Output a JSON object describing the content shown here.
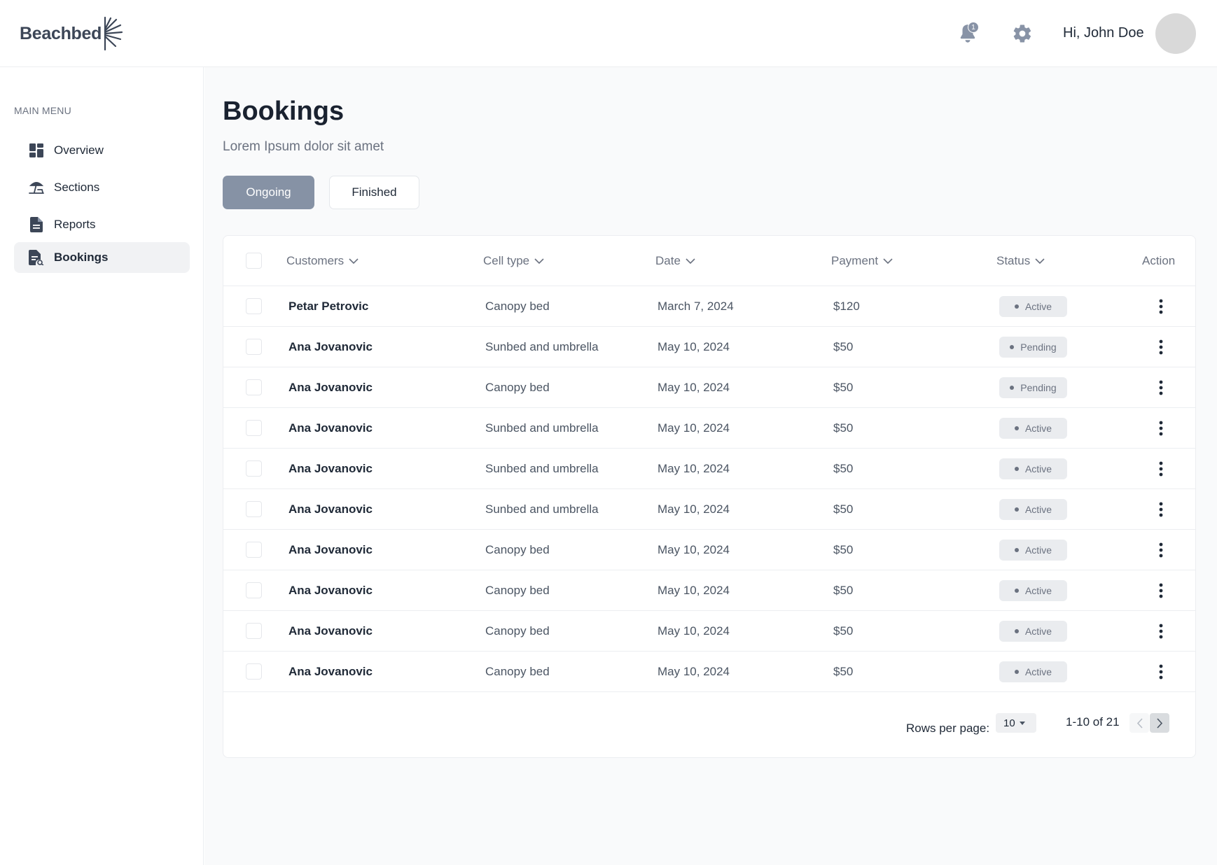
{
  "app": {
    "brand": "Beachbed"
  },
  "header": {
    "notification_count": "1",
    "greeting": "Hi, John Doe"
  },
  "sidebar": {
    "heading": "MAIN MENU",
    "items": [
      {
        "label": "Overview",
        "icon": "dashboard-icon"
      },
      {
        "label": "Sections",
        "icon": "beach-umbrella-icon"
      },
      {
        "label": "Reports",
        "icon": "document-icon"
      },
      {
        "label": "Bookings",
        "icon": "bookings-icon",
        "active": true
      }
    ]
  },
  "page": {
    "title": "Bookings",
    "subtitle": "Lorem Ipsum dolor sit amet",
    "tabs": [
      {
        "label": "Ongoing",
        "active": true
      },
      {
        "label": "Finished",
        "active": false
      }
    ]
  },
  "table": {
    "columns": {
      "customers": "Customers",
      "cell_type": "Cell type",
      "date": "Date",
      "payment": "Payment",
      "status": "Status",
      "action": "Action"
    },
    "rows": [
      {
        "customer": "Petar Petrovic",
        "cell_type": "Canopy bed",
        "date": "March 7, 2024",
        "payment": "$120",
        "status": "Active"
      },
      {
        "customer": "Ana Jovanovic",
        "cell_type": "Sunbed and umbrella",
        "date": "May 10, 2024",
        "payment": "$50",
        "status": "Pending"
      },
      {
        "customer": "Ana Jovanovic",
        "cell_type": "Canopy bed",
        "date": "May 10, 2024",
        "payment": "$50",
        "status": "Pending"
      },
      {
        "customer": "Ana Jovanovic",
        "cell_type": "Sunbed and umbrella",
        "date": "May 10, 2024",
        "payment": "$50",
        "status": "Active"
      },
      {
        "customer": "Ana Jovanovic",
        "cell_type": "Sunbed and umbrella",
        "date": "May 10, 2024",
        "payment": "$50",
        "status": "Active"
      },
      {
        "customer": "Ana Jovanovic",
        "cell_type": "Sunbed and umbrella",
        "date": "May 10, 2024",
        "payment": "$50",
        "status": "Active"
      },
      {
        "customer": "Ana Jovanovic",
        "cell_type": "Canopy bed",
        "date": "May 10, 2024",
        "payment": "$50",
        "status": "Active"
      },
      {
        "customer": "Ana Jovanovic",
        "cell_type": "Canopy bed",
        "date": "May 10, 2024",
        "payment": "$50",
        "status": "Active"
      },
      {
        "customer": "Ana Jovanovic",
        "cell_type": "Canopy bed",
        "date": "May 10, 2024",
        "payment": "$50",
        "status": "Active"
      },
      {
        "customer": "Ana Jovanovic",
        "cell_type": "Canopy bed",
        "date": "May 10, 2024",
        "payment": "$50",
        "status": "Active"
      }
    ],
    "pagination": {
      "rows_per_page_label": "Rows per page:",
      "rows_per_page": "10",
      "range": "1-10 of 21"
    }
  },
  "colors": {
    "accent": "#8692a5",
    "badge_bg": "#eaecef",
    "main_bg": "#f9fafb"
  }
}
